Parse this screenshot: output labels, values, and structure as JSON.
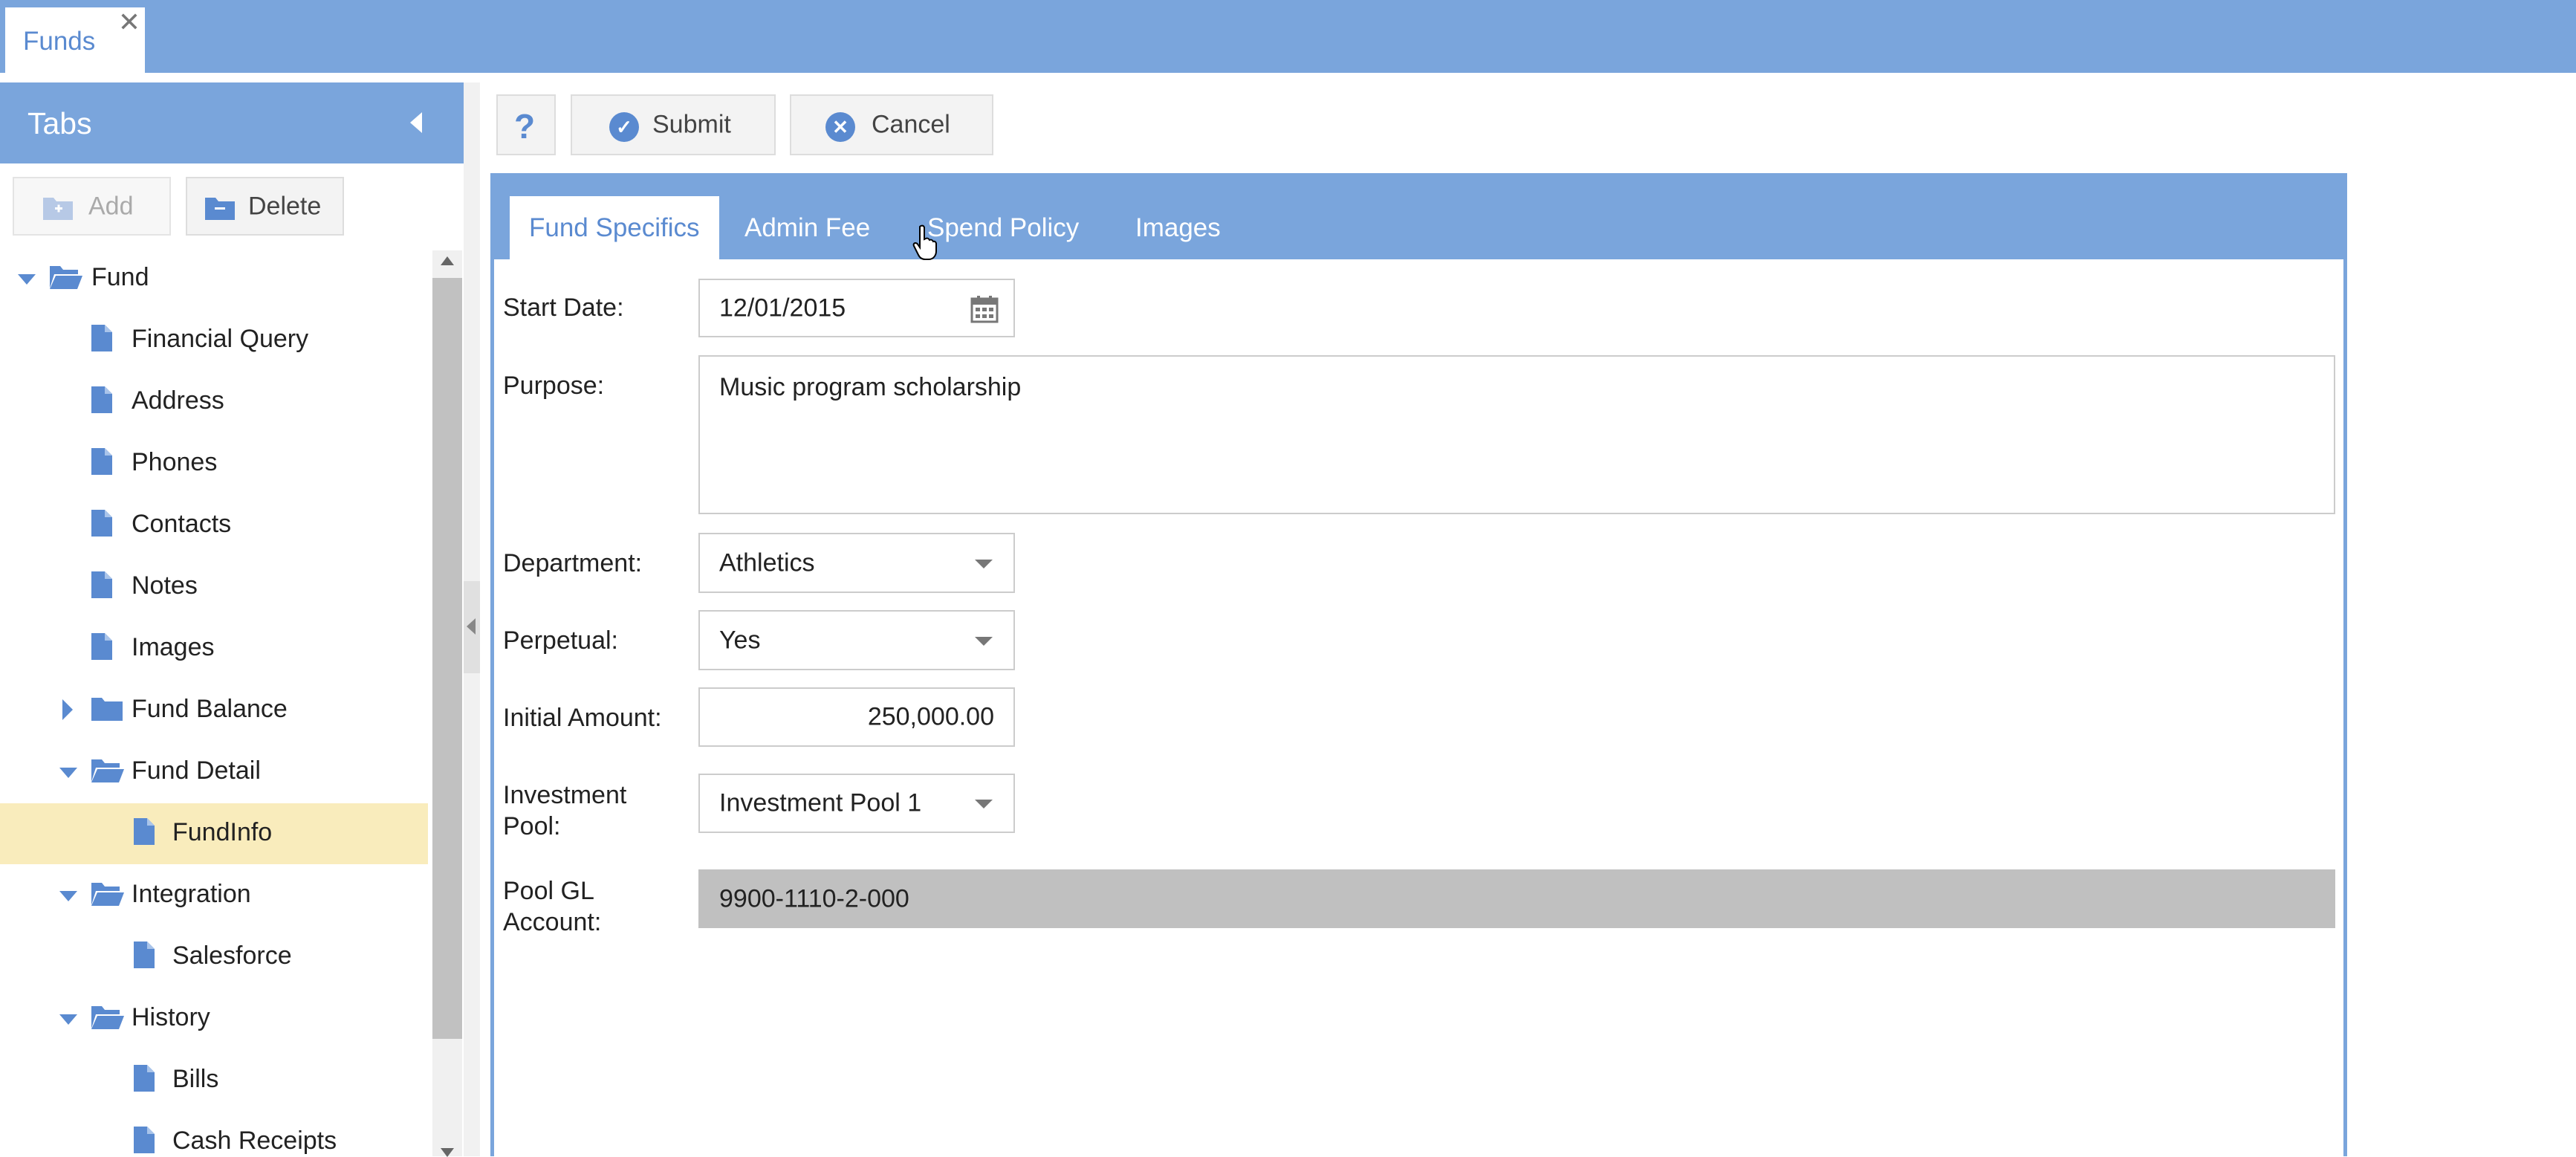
{
  "window": {
    "doc_tab": "Funds",
    "close_glyph": "✕"
  },
  "sidebar": {
    "title": "Tabs",
    "add_label": "Add",
    "delete_label": "Delete",
    "tree": [
      {
        "label": "Fund",
        "type": "folder-open",
        "level": 0,
        "expand": "expanded"
      },
      {
        "label": "Financial Query",
        "type": "file",
        "level": 1
      },
      {
        "label": "Address",
        "type": "file",
        "level": 1
      },
      {
        "label": "Phones",
        "type": "file",
        "level": 1
      },
      {
        "label": "Contacts",
        "type": "file",
        "level": 1
      },
      {
        "label": "Notes",
        "type": "file",
        "level": 1
      },
      {
        "label": "Images",
        "type": "file",
        "level": 1
      },
      {
        "label": "Fund Balance",
        "type": "folder",
        "level": 1,
        "expand": "collapsed"
      },
      {
        "label": "Fund Detail",
        "type": "folder-open",
        "level": 1,
        "expand": "expanded"
      },
      {
        "label": "FundInfo",
        "type": "file",
        "level": 2,
        "selected": true
      },
      {
        "label": "Integration",
        "type": "folder-open",
        "level": 1,
        "expand": "expanded"
      },
      {
        "label": "Salesforce",
        "type": "file",
        "level": 2
      },
      {
        "label": "History",
        "type": "folder-open",
        "level": 1,
        "expand": "expanded"
      },
      {
        "label": "Bills",
        "type": "file",
        "level": 2
      },
      {
        "label": "Cash Receipts",
        "type": "file",
        "level": 2
      }
    ]
  },
  "toolbar": {
    "help_glyph": "?",
    "submit_label": "Submit",
    "cancel_label": "Cancel"
  },
  "tabs": {
    "fund_specifics": "Fund Specifics",
    "admin_fee": "Admin Fee",
    "spend_policy": "Spend Policy",
    "images": "Images"
  },
  "form": {
    "start_date": {
      "label": "Start Date:",
      "value": "12/01/2015"
    },
    "purpose": {
      "label": "Purpose:",
      "value": "Music program scholarship"
    },
    "department": {
      "label": "Department:",
      "value": "Athletics"
    },
    "perpetual": {
      "label": "Perpetual:",
      "value": "Yes"
    },
    "initial_amount": {
      "label": "Initial Amount:",
      "value": "250,000.00"
    },
    "investment_pool": {
      "label_line1": "Investment",
      "label_line2": "Pool:",
      "value": "Investment Pool 1"
    },
    "pool_gl_account": {
      "label_line1": "Pool GL",
      "label_line2": "Account:",
      "value": "9900-1110-2-000"
    }
  },
  "colors": {
    "accent": "#7aa5dc",
    "accent_dark": "#5a8ad0",
    "selected_row": "#f9ecbc",
    "readonly_field": "#c0c0c0"
  }
}
